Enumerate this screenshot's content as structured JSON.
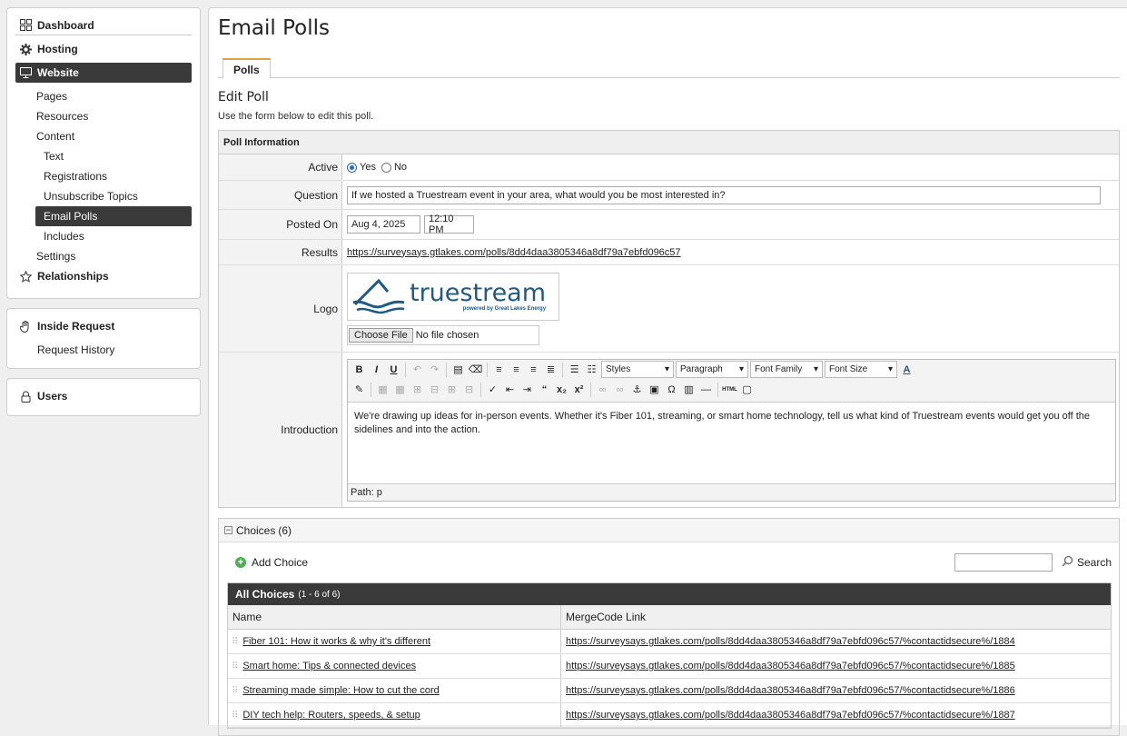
{
  "sidebar": {
    "nav": {
      "dashboard": "Dashboard",
      "hosting": "Hosting",
      "website": "Website",
      "pages": "Pages",
      "resources": "Resources",
      "content": "Content",
      "text": "Text",
      "registrations": "Registrations",
      "unsubscribe_topics": "Unsubscribe Topics",
      "email_polls": "Email Polls",
      "includes": "Includes",
      "settings": "Settings",
      "relationships": "Relationships"
    },
    "inside_request": "Inside Request",
    "request_history": "Request History",
    "users": "Users"
  },
  "main": {
    "title": "Email Polls",
    "tab": "Polls",
    "section_title": "Edit Poll",
    "section_desc": "Use the form below to edit this poll.",
    "poll_info_header": "Poll Information",
    "fields": {
      "active_label": "Active",
      "active_yes": "Yes",
      "active_no": "No",
      "question_label": "Question",
      "question_value": "If we hosted a Truestream event in your area, what would you be most interested in?",
      "posted_label": "Posted On",
      "posted_date": "Aug 4, 2025",
      "posted_time": "12:10 PM",
      "results_label": "Results",
      "results_link": "https://surveysays.gtlakes.com/polls/8dd4daa3805346a8df79a7ebfd096c57",
      "logo_label": "Logo",
      "logo_word": "truestream",
      "logo_tagline": "powered by Great Lakes Energy",
      "choose_file": "Choose File",
      "no_file": "No file chosen",
      "intro_label": "Introduction",
      "intro_text": "We're drawing up ideas for in-person events. Whether it's Fiber 101, streaming, or smart home technology, tell us what kind of Truestream events would get you off the sidelines and into the action.",
      "path": "Path: p"
    },
    "editor": {
      "styles": "Styles",
      "paragraph": "Paragraph",
      "font_family": "Font Family",
      "font_size": "Font Size"
    },
    "choices": {
      "header": "Choices",
      "count": "(6)",
      "add_choice": "Add Choice",
      "search": "Search",
      "all_choices": "All Choices",
      "range": "(1 - 6 of 6)",
      "col_name": "Name",
      "col_merge": "MergeCode Link",
      "rows": [
        {
          "name": "Fiber 101: How it works & why it's different",
          "link": "https://surveysays.gtlakes.com/polls/8dd4daa3805346a8df79a7ebfd096c57/%contactidsecure%/1884"
        },
        {
          "name": "Smart home: Tips & connected devices",
          "link": "https://surveysays.gtlakes.com/polls/8dd4daa3805346a8df79a7ebfd096c57/%contactidsecure%/1885"
        },
        {
          "name": "Streaming made simple: How to cut the cord",
          "link": "https://surveysays.gtlakes.com/polls/8dd4daa3805346a8df79a7ebfd096c57/%contactidsecure%/1886"
        },
        {
          "name": "DIY tech help: Routers, speeds, & setup",
          "link": "https://surveysays.gtlakes.com/polls/8dd4daa3805346a8df79a7ebfd096c57/%contactidsecure%/1887"
        }
      ]
    }
  },
  "colors": {
    "active_bg": "#3a3a3a",
    "tab_accent": "#e0a040",
    "radio_blue": "#2a66c8",
    "logo_blue": "#1f5a86",
    "add_green": "#4caf50"
  }
}
